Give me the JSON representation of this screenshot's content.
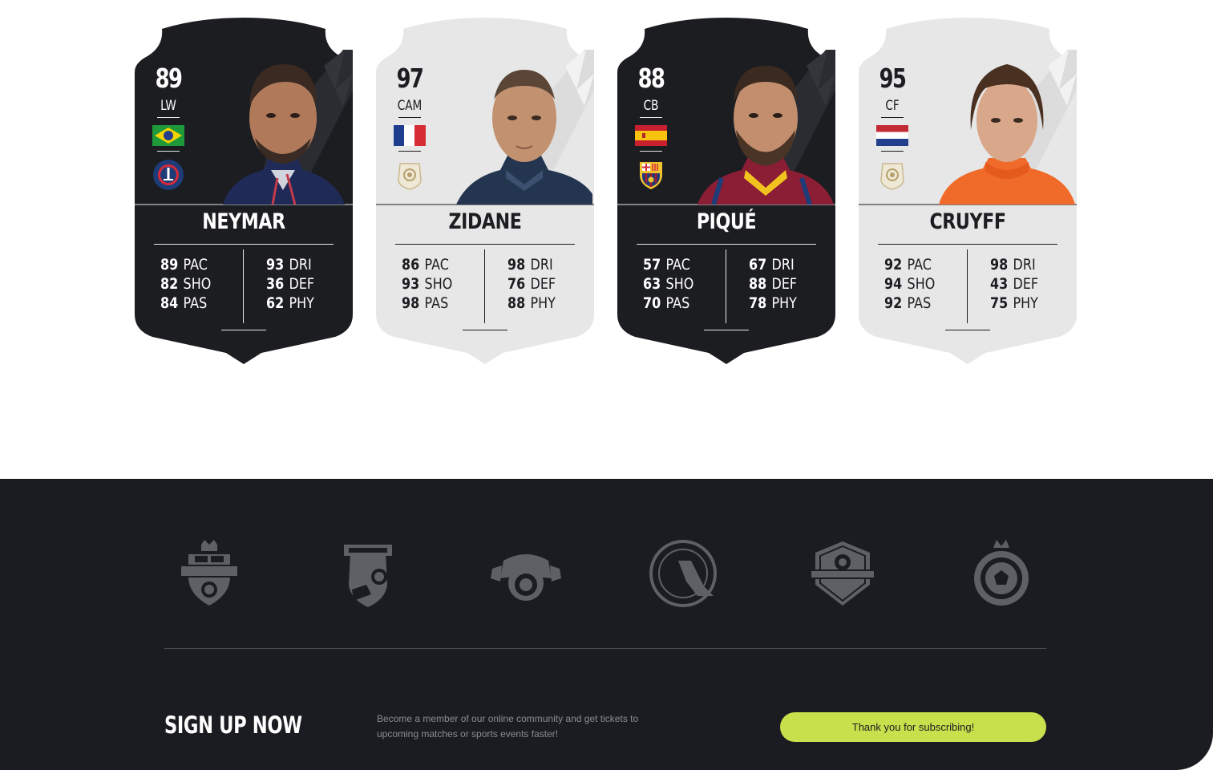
{
  "cards": [
    {
      "rating": "89",
      "position": "LW",
      "name": "NEYMAR",
      "flag": "brazil-flag",
      "club": "psg-crest",
      "stats_left": [
        {
          "v": "89",
          "k": "PAC"
        },
        {
          "v": "82",
          "k": "SHO"
        },
        {
          "v": "84",
          "k": "PAS"
        }
      ],
      "stats_right": [
        {
          "v": "93",
          "k": "DRI"
        },
        {
          "v": "36",
          "k": "DEF"
        },
        {
          "v": "62",
          "k": "PHY"
        }
      ]
    },
    {
      "rating": "97",
      "position": "CAM",
      "name": "ZIDANE",
      "flag": "france-flag",
      "club": "icon-badge",
      "stats_left": [
        {
          "v": "86",
          "k": "PAC"
        },
        {
          "v": "93",
          "k": "SHO"
        },
        {
          "v": "98",
          "k": "PAS"
        }
      ],
      "stats_right": [
        {
          "v": "98",
          "k": "DRI"
        },
        {
          "v": "76",
          "k": "DEF"
        },
        {
          "v": "88",
          "k": "PHY"
        }
      ]
    },
    {
      "rating": "88",
      "position": "CB",
      "name": "PIQUÉ",
      "flag": "spain-flag",
      "club": "barcelona-crest",
      "stats_left": [
        {
          "v": "57",
          "k": "PAC"
        },
        {
          "v": "63",
          "k": "SHO"
        },
        {
          "v": "70",
          "k": "PAS"
        }
      ],
      "stats_right": [
        {
          "v": "67",
          "k": "DRI"
        },
        {
          "v": "88",
          "k": "DEF"
        },
        {
          "v": "78",
          "k": "PHY"
        }
      ]
    },
    {
      "rating": "95",
      "position": "CF",
      "name": "CRUYFF",
      "flag": "netherlands-flag",
      "club": "icon-badge",
      "stats_left": [
        {
          "v": "92",
          "k": "PAC"
        },
        {
          "v": "94",
          "k": "SHO"
        },
        {
          "v": "92",
          "k": "PAS"
        }
      ],
      "stats_right": [
        {
          "v": "98",
          "k": "DRI"
        },
        {
          "v": "43",
          "k": "DEF"
        },
        {
          "v": "75",
          "k": "PHY"
        }
      ]
    }
  ],
  "footer": {
    "logos": [
      "football-logo",
      "football-shield-logo",
      "football-cup-logo",
      "soccer-cup-logo",
      "tournament-logo",
      "football-club-logo"
    ],
    "signup_title": "SIGN UP NOW",
    "signup_text": "Become a member of our online community and get tickets to upcoming matches or sports events faster!",
    "subscribe_label": "Thank you for subscribing!"
  },
  "colors": {
    "card_dark": "#1c1d21",
    "card_light": "#e7e7e7",
    "footer_bg": "#1b1c21",
    "accent": "#c8e04b",
    "logo_gray": "#5f6066"
  }
}
